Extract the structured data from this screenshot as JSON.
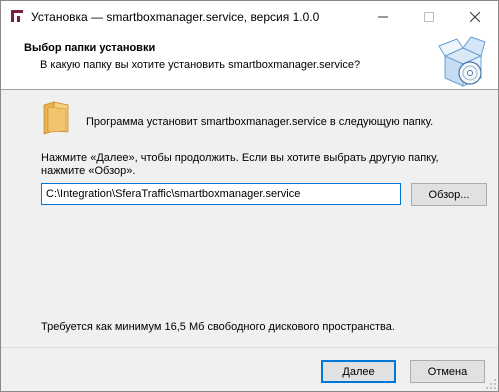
{
  "window": {
    "title": "Установка — smartboxmanager.service, версия 1.0.0",
    "minimize_glyph": "—",
    "maximize_glyph": "☐",
    "close_glyph": "✕"
  },
  "header": {
    "title": "Выбор папки установки",
    "subtitle": "В какую папку вы хотите установить smartboxmanager.service?",
    "logo_icon": "installer-box-cd-icon"
  },
  "content": {
    "folder_icon": "folder-icon",
    "intro": "Программа установит smartboxmanager.service в следующую папку.",
    "description": "Нажмите «Далее», чтобы продолжить. Если вы хотите выбрать другую папку, нажмите «Обзор».",
    "path_value": "C:\\Integration\\SferaTraffic\\smartboxmanager.service",
    "browse_label": "Обзор...",
    "space_required": "Требуется как минимум 16,5 Мб свободного дискового пространства."
  },
  "footer": {
    "next_label": "Далее",
    "cancel_label": "Отмена"
  },
  "colors": {
    "accent": "#0078d7",
    "app_icon": "#7b1f3a",
    "folder": "#f2c46d"
  }
}
